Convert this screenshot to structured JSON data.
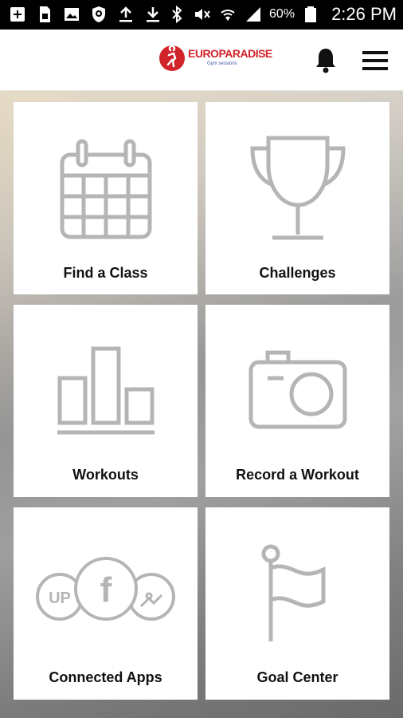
{
  "status_bar": {
    "battery_percent": "60%",
    "time": "2:26 PM",
    "left_icons": [
      "add-box-icon",
      "sim-icon",
      "image-icon",
      "shield-icon",
      "upload-icon",
      "download-icon"
    ],
    "right_icons": [
      "bluetooth-icon",
      "mute-icon",
      "wifi-icon",
      "signal-icon",
      "battery-icon"
    ]
  },
  "header": {
    "logo_text": "EUROPARADISE",
    "logo_subtext": "Gym sessions",
    "icons": [
      "bell-icon",
      "menu-icon"
    ]
  },
  "tiles": [
    {
      "label": "Find a Class",
      "icon": "calendar-icon"
    },
    {
      "label": "Challenges",
      "icon": "trophy-icon"
    },
    {
      "label": "Workouts",
      "icon": "bar-chart-icon"
    },
    {
      "label": "Record a Workout",
      "icon": "camera-icon"
    },
    {
      "label": "Connected Apps",
      "icon": "connected-apps-icon",
      "icon_text": {
        "up": "UP",
        "facebook": "f"
      }
    },
    {
      "label": "Goal Center",
      "icon": "flag-icon"
    }
  ],
  "colors": {
    "brand_red": "#d0232a",
    "icon_gray": "#b5b5b5",
    "label": "#111111"
  }
}
